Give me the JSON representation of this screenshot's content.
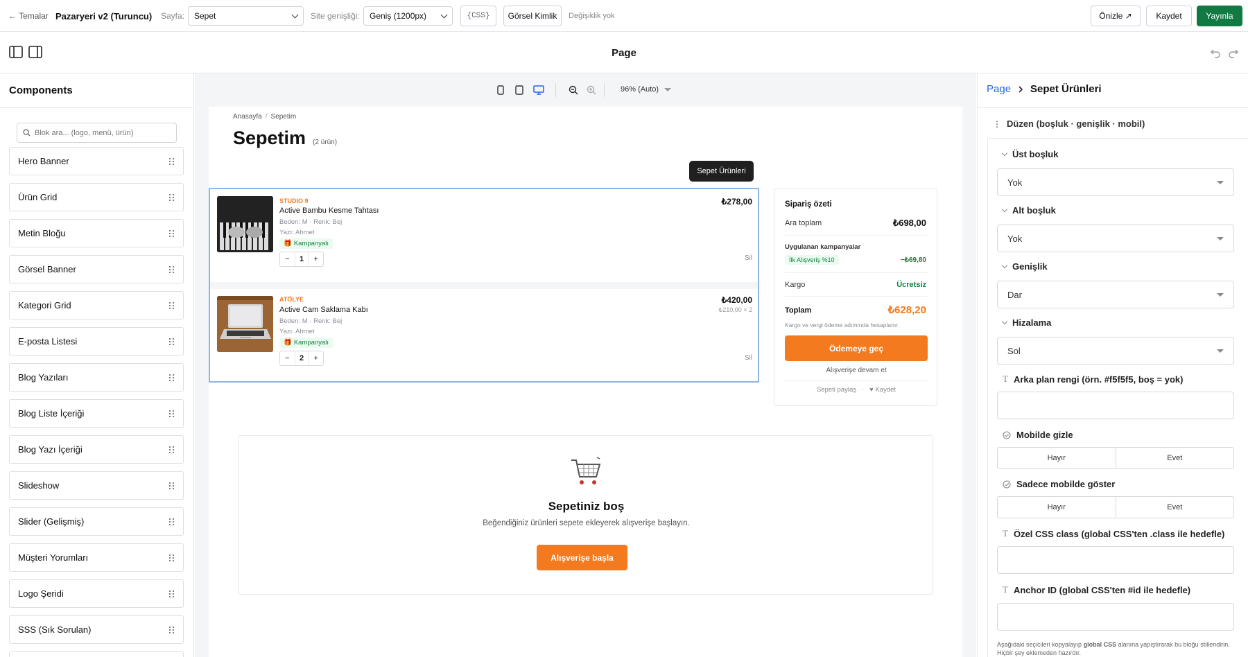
{
  "topbar": {
    "back": "← Temalar",
    "theme_name": "Pazaryeri v2 (Turuncu)",
    "page_label": "Sayfa:",
    "page_value": "Sepet",
    "width_label": "Site genişliği:",
    "width_value": "Geniş (1200px)",
    "css_btn": "{CSS}",
    "identity_btn": "Görsel Kimlik",
    "status": "Değişiklik yok",
    "preview_btn": "Önizle ↗",
    "save_btn": "Kaydet",
    "publish_btn": "Yayınla",
    "accent": "#117a43"
  },
  "pagebar": {
    "title": "Page"
  },
  "components": {
    "title": "Components",
    "search_placeholder": "Blok ara... (logo, menü, ürün)",
    "items": [
      "Hero Banner",
      "Ürün Grid",
      "Metin Bloğu",
      "Görsel Banner",
      "Kategori Grid",
      "E-posta Listesi",
      "Blog Yazıları",
      "Blog Liste İçeriği",
      "Blog Yazı İçeriği",
      "Slideshow",
      "Slider (Gelişmiş)",
      "Müşteri Yorumları",
      "Logo Şeridi",
      "SSS (Sık Sorulan)"
    ]
  },
  "canvas_toolbar": {
    "zoom": "96% (Auto)"
  },
  "preview": {
    "breadcrumb_home": "Anasayfa",
    "breadcrumb_sep": "/",
    "breadcrumb_current": "Sepetim",
    "heading": "Sepetim",
    "count": "(2 ürün)",
    "selection_chip": "Sepet Ürünleri",
    "items": [
      {
        "brand": "STUDIO 9",
        "name": "Active Bambu Kesme Tahtası",
        "variant": "Beden: M · Renk: Bej",
        "note": "Yazı: Ahmet",
        "tag": "Kampanyalı",
        "qty": "1",
        "price": "₺278,00",
        "unit": "",
        "remove": "Sil"
      },
      {
        "brand": "ATÖLYE",
        "name": "Active Cam Saklama Kabı",
        "variant": "Beden: M · Renk: Bej",
        "note": "Yazı: Ahmet",
        "tag": "Kampanyalı",
        "qty": "2",
        "price": "₺420,00",
        "unit": "₺210,00 × 2",
        "remove": "Sil"
      }
    ],
    "summary": {
      "title": "Sipariş özeti",
      "subtotal_label": "Ara toplam",
      "subtotal": "₺698,00",
      "campaigns_label": "Uygulanan kampanyalar",
      "campaign_name": "İlk Alışveriş %10",
      "campaign_value": "−₺69,80",
      "shipping_label": "Kargo",
      "shipping_value": "Ücretsiz",
      "total_label": "Toplam",
      "total": "₺628,20",
      "tax_note": "Kargo ve vergi ödeme adımında hesaplanır.",
      "checkout_btn": "Ödemeye geç",
      "continue_link": "Alışverişe devam et",
      "share": "Sepeti paylaş",
      "dot": "·",
      "save": "♥ Kaydet"
    },
    "empty": {
      "title": "Sepetiniz boş",
      "text": "Beğendiğiniz ürünleri sepete ekleyerek alışverişe başlayın.",
      "button": "Alışverişe başla"
    },
    "accent": "#f47a20",
    "green": "#15803d"
  },
  "inspector": {
    "breadcrumb_root": "Page",
    "breadcrumb_current": "Sepet Ürünleri",
    "group": "Düzen (boşluk · genişlik · mobil)",
    "top_label": "Üst boşluk",
    "top_value": "Yok",
    "bottom_label": "Alt boşluk",
    "bottom_value": "Yok",
    "width_label": "Genişlik",
    "width_value": "Dar",
    "align_label": "Hizalama",
    "align_value": "Sol",
    "bg_label": "Arka plan rengi (örn. #f5f5f5, boş = yok)",
    "hide_mobile_label": "Mobilde gizle",
    "only_mobile_label": "Sadece mobilde göster",
    "no": "Hayır",
    "yes": "Evet",
    "css_class_label": "Özel CSS class (global CSS'ten .class ile hedefle)",
    "anchor_label": "Anchor ID (global CSS'ten #id ile hedefle)",
    "footnote_1": "Aşağıdaki seçicileri kopyalayıp",
    "footnote_bold": "global CSS",
    "footnote_2": "alanına yapıştırarak bu bloğu",
    "footnote_3": "stillendirin. Hiçbir şey eklemeden hazırdır."
  }
}
